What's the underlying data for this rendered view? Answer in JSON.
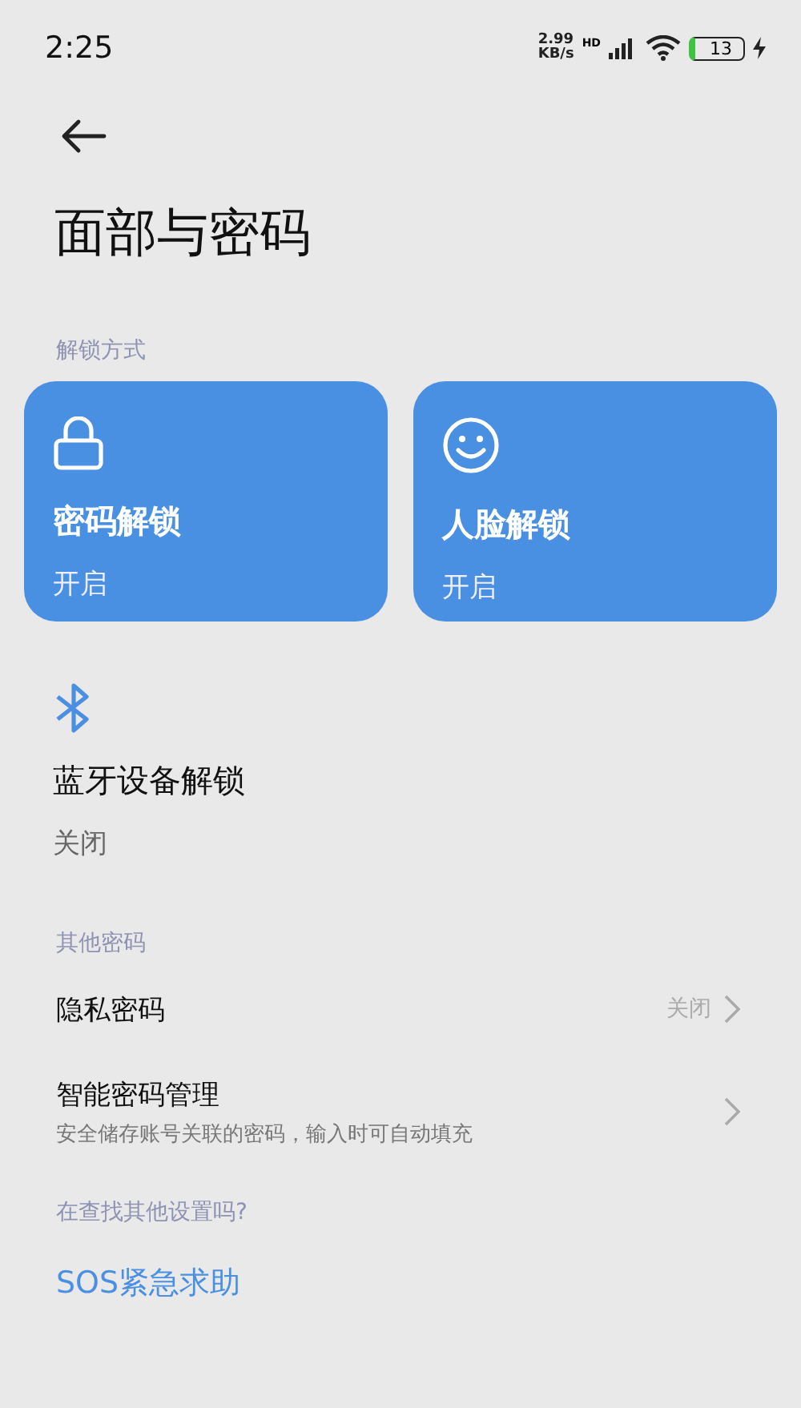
{
  "status_bar": {
    "time": "2:25",
    "speed": "2.99",
    "speed_unit": "KB/s",
    "network": "HD",
    "battery": "13"
  },
  "title": "面部与密码",
  "unlock_section": {
    "label": "解锁方式",
    "methods": [
      {
        "kind": "lock",
        "title": "密码解锁",
        "state": "开启",
        "on": true
      },
      {
        "kind": "face",
        "title": "人脸解锁",
        "state": "开启",
        "on": true
      },
      {
        "kind": "bluetooth",
        "title": "蓝牙设备解锁",
        "state": "关闭",
        "on": false
      }
    ]
  },
  "other_section": {
    "label": "其他密码",
    "items": [
      {
        "title": "隐私密码",
        "value": "关闭"
      },
      {
        "title": "智能密码管理",
        "subtitle": "安全储存账号关联的密码，输入时可自动填充"
      }
    ]
  },
  "suggest": {
    "label": "在查找其他设置吗?",
    "links": [
      "SOS紧急求助"
    ]
  }
}
